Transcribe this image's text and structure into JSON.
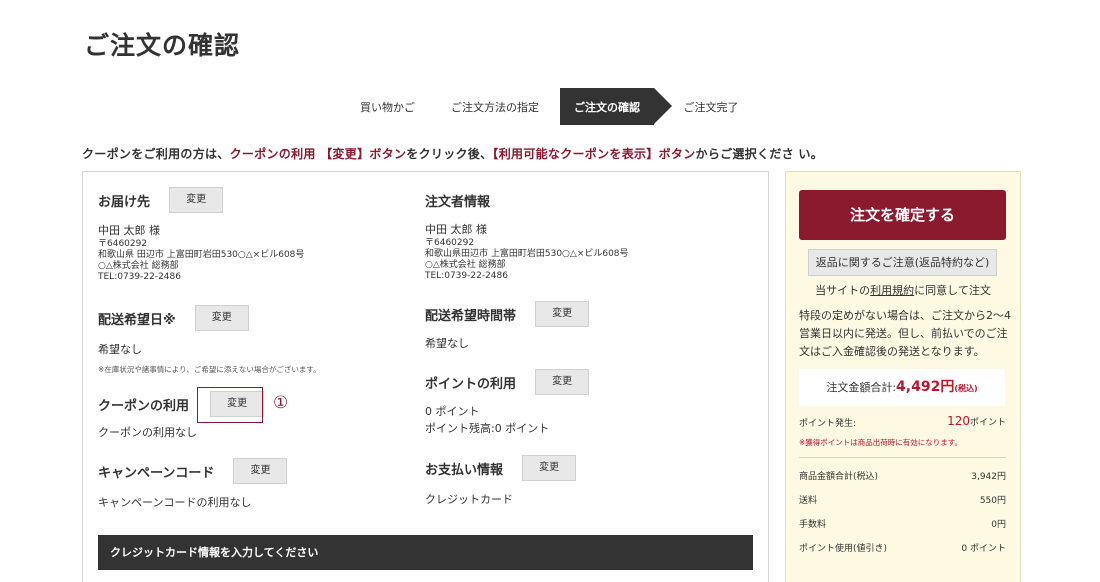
{
  "page": {
    "title": "ご注文の確認"
  },
  "steps": [
    {
      "label": "買い物かご"
    },
    {
      "label": "ご注文方法の指定"
    },
    {
      "label": "ご注文の確認"
    },
    {
      "label": "ご注文完了"
    }
  ],
  "notice": {
    "p1": "クーポンをご利用の方は、",
    "p2": "クーポンの利用 【変更】ボタン",
    "p3": "をクリック後、",
    "p4": "【利用可能なクーポンを表示】ボタン",
    "p5": "からご選択くださ い。"
  },
  "change_label": "変更",
  "delivery": {
    "title": "お届け先",
    "name": "中田 太郎 様",
    "zip": "〒6460292",
    "address": "和歌山県 田辺市 上富田町岩田530○△×ビル608号",
    "company": "○△株式会社 総務部",
    "tel": "TEL:0739-22-2486"
  },
  "orderer": {
    "title": "注文者情報",
    "name": "中田 太郎 様",
    "zip": "〒6460292",
    "address": "和歌山県田辺市 上富田町岩田530○△×ビル608号",
    "company": "○△株式会社 総務部",
    "tel": "TEL:0739-22-2486"
  },
  "delivery_date": {
    "title": "配送希望日※",
    "value": "希望なし",
    "note": "※在庫状況や諸事情により、ご希望に添えない場合がございます。"
  },
  "delivery_time": {
    "title": "配送希望時間帯",
    "value": "希望なし"
  },
  "coupon": {
    "title": "クーポンの利用",
    "value": "クーポンの利用なし",
    "marker": "①"
  },
  "points": {
    "title": "ポイントの利用",
    "used": "0 ポイント",
    "balance": "ポイント残高:0 ポイント"
  },
  "campaign": {
    "title": "キャンペーンコード",
    "value": "キャンペーンコードの利用なし"
  },
  "payment": {
    "title": "お支払い情報",
    "value": "クレジットカード"
  },
  "credit_bar": "クレジットカード情報を入力してください",
  "side": {
    "confirm": "注文を確定する",
    "return_btn": "返品に関するご注意(返品特約など)",
    "agree_pre": "当サイトの",
    "agree_link": "利用規約",
    "agree_post": "に同意して注文",
    "ship_note": "特段の定めがない場合は、ご注文から2〜4営業日以内に発送。但し、前払いでのご注文はご入金確認後の発送となります。",
    "total_label": "注文金額合計:",
    "total_amount": "4,492円",
    "total_tax": "(税込)",
    "pt_label": "ポイント発生:",
    "pt_value": "120",
    "pt_unit": "ポイント",
    "pt_note": "※獲得ポイントは商品出荷時に有効になります。",
    "rows": [
      {
        "label": "商品金額合計(税込)",
        "value": "3,942円"
      },
      {
        "label": "送料",
        "value": "550円"
      },
      {
        "label": "手数料",
        "value": "0円"
      },
      {
        "label": "ポイント使用(値引き)",
        "value": "0 ポイント"
      }
    ]
  },
  "colors": {
    "accent": "#8b1a2e",
    "price": "#c0142b",
    "side_bg": "#fdf9e3",
    "dark_bar": "#333333"
  }
}
